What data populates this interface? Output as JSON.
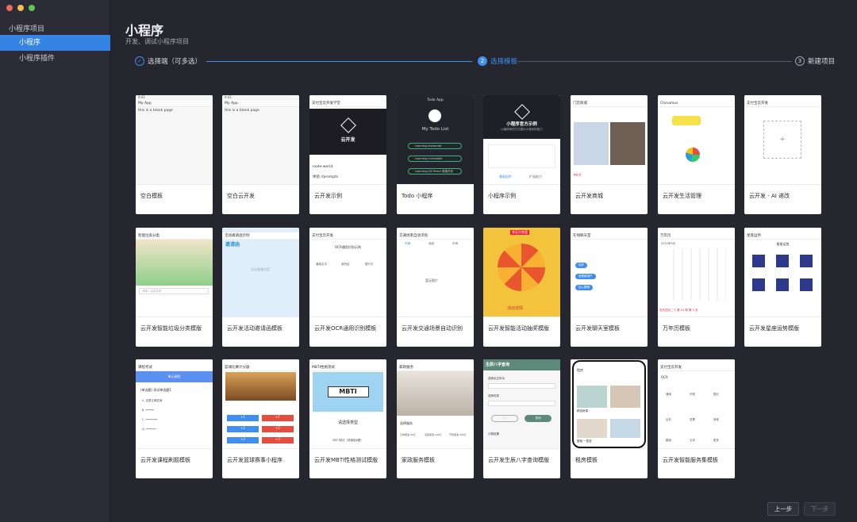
{
  "sidebar": {
    "group": "小程序项目",
    "items": [
      {
        "label": "小程序",
        "active": true
      },
      {
        "label": "小程序插件",
        "active": false
      }
    ]
  },
  "page": {
    "title": "小程序",
    "subtitle": "开发、调试小程序项目"
  },
  "steps": [
    {
      "num": "✓",
      "label": "选择端（可多选）",
      "state": "done"
    },
    {
      "num": "2",
      "label": "选择模板",
      "state": "active"
    },
    {
      "num": "3",
      "label": "新建项目",
      "state": "pending"
    }
  ],
  "templates": [
    {
      "name": "空白模板"
    },
    {
      "name": "空白云开发"
    },
    {
      "name": "云开发示例"
    },
    {
      "name": "Todo 小程序"
    },
    {
      "name": "小程序示例"
    },
    {
      "name": "云开发商城"
    },
    {
      "name": "云开发生活管理"
    },
    {
      "name": "云开发 - AI 递改"
    },
    {
      "name": "云开发智能垃圾分类模版"
    },
    {
      "name": "云开发活动邀请函模板"
    },
    {
      "name": "云开发OCR通用识别模板"
    },
    {
      "name": "云开发交通场景自动识别"
    },
    {
      "name": "云开发智能活动抽奖模版"
    },
    {
      "name": "云开发聊天室模板"
    },
    {
      "name": "万年历模板"
    },
    {
      "name": "云开发星座运势模版"
    },
    {
      "name": "云开发课程刷题模板"
    },
    {
      "name": "云开发篮球赛事小程序"
    },
    {
      "name": "云开发MBTI性格测试模版"
    },
    {
      "name": "家政服务模板"
    },
    {
      "name": "云开发生辰八字查询模版"
    },
    {
      "name": "租房模板"
    },
    {
      "name": "云开发智能服务集模板"
    }
  ],
  "previews": {
    "blank_title": "My App",
    "blank_text": "this is a blank page",
    "cloud_header": "支付宝云开发学堂",
    "cloud_title": "云开发",
    "cloud_item1": "node-world",
    "cloud_item2": "体验 //prompts",
    "todo_header": "Todo App",
    "todo_title": "My Todo List",
    "todo_items": [
      "Learning Javascript",
      "Learning minirabbit",
      "Learning JSX React 表格开发"
    ],
    "demo_title": "小程序官方示例",
    "demo_sub": "以最简单的方式展示小程序的能力",
    "demo_tabs": [
      "基础组件",
      "扩展能力"
    ],
    "mall_header": "门店商城",
    "mall_price": "¥9.9",
    "life_header": "Chinamus",
    "ai_header": "支付宝云开发",
    "ai_box": "+",
    "garbage_header": "智能垃圾分类",
    "garbage_search": "请输入垃圾名称",
    "invite_header": "活动邀请函示例",
    "invite_title": "邀请函",
    "invite_body": "活动邀请内容",
    "ocr_header": "支付宝云开发",
    "ocr_top": "OCR通用识别示例",
    "ocr_items": [
      "通用文字",
      "身份证",
      "银行卡"
    ],
    "traffic_header": "交通场景自动识别",
    "traffic_tabs": [
      "车辆",
      "道路",
      "车牌"
    ],
    "traffic_body": "暂无图片",
    "lottery_tag": "幸运大转盘",
    "lottery_btn": "活动详情",
    "chat_header": "在线聊天室",
    "chat_tags": [
      "你好",
      "我是新用户",
      "加入群聊"
    ],
    "cal_title": "万年历",
    "cal_month": "2022年9月",
    "cal_footer": "农历四月二十 第 22 周 第 3 天",
    "star_header": "星座运势",
    "star_sub": "星座运势",
    "course_header": "课程考试",
    "course_sub": "单元测验",
    "course_q": "(单选题) 测试单选题1",
    "course_opts": [
      "A. 这是正确答案",
      "B. ━━━━━",
      "C. ━━━━━━━",
      "D. ━━━━━━"
    ],
    "basket_header": "篮球比赛计分器",
    "basket_scores": [
      "+1",
      "+2",
      "+3"
    ],
    "mbti_header": "MBTI性格测试",
    "mbti_logo": "MBTI",
    "mbti_pick": "请选择类型",
    "mbti_foot": "MBTI测试（简速版6题）",
    "house_header": "家政服务",
    "house_sub": "选择服务",
    "house_prices": [
      "日常保洁 99元",
      "深度保洁 199元",
      "开荒保洁 299元"
    ],
    "bazi_header": "生辰八字查询",
    "bazi_f1": "选择出生年月",
    "bazi_f2": "选择时辰",
    "bazi_btn1": "重置",
    "bazi_btn2": "查询",
    "bazi_foot": "计算结果",
    "rent_title": "租房",
    "rent_items": [
      "精选房源",
      "整租·一居室"
    ],
    "smart_header": "支付宝云开发",
    "smart_top": "OCR",
    "smart_rows": [
      "通用",
      "识别",
      "图片",
      "证件",
      "发票",
      "其他",
      "翻译",
      "文本",
      "更多"
    ]
  },
  "colors": {
    "accent": "#3f8ef0",
    "sidebar_active": "#3583e4"
  },
  "footer": {
    "prev": "上一步",
    "next": "下一步"
  }
}
